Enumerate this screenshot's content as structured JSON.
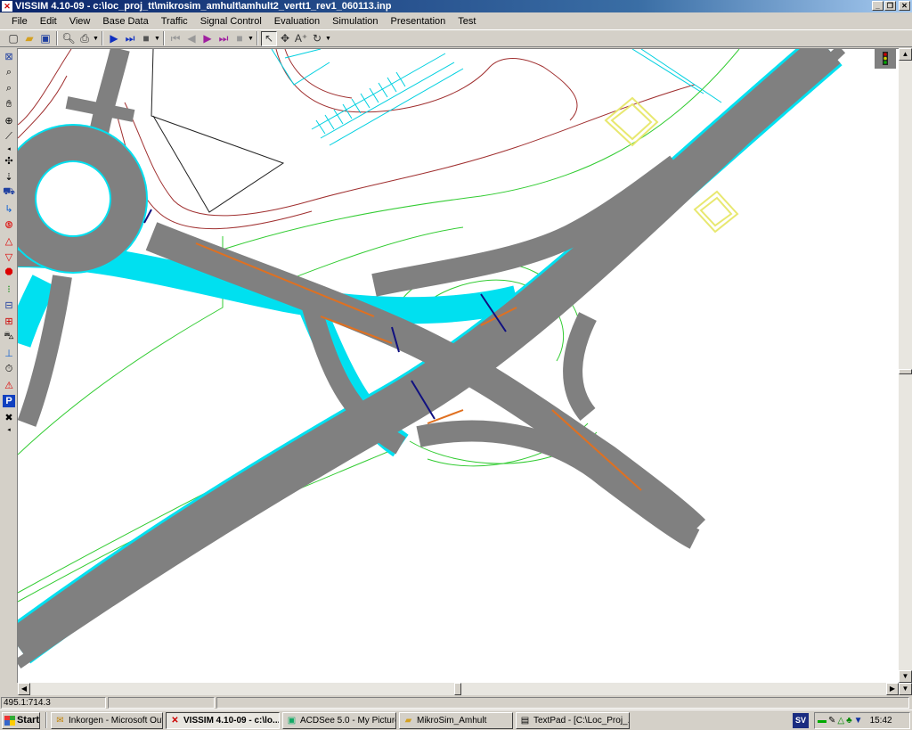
{
  "window": {
    "title": "VISSIM 4.10-09 - c:\\loc_proj_tt\\mikrosim_amhult\\amhult2_vertt1_rev1_060113.inp"
  },
  "menu": [
    {
      "label": "File"
    },
    {
      "label": "Edit"
    },
    {
      "label": "View"
    },
    {
      "label": "Base Data"
    },
    {
      "label": "Traffic"
    },
    {
      "label": "Signal Control"
    },
    {
      "label": "Evaluation"
    },
    {
      "label": "Simulation"
    },
    {
      "label": "Presentation"
    },
    {
      "label": "Test"
    }
  ],
  "toolbar": {
    "icons": [
      "new-file",
      "open-folder",
      "save-disk",
      "print-preview",
      "print",
      "play",
      "step",
      "stop",
      "rewind",
      "back",
      "forward-animation",
      "forward-step",
      "stop-animation",
      "select-pointer",
      "move-network",
      "add-text",
      "rotate"
    ]
  },
  "palette": {
    "icons": [
      "network-window",
      "zoom-in",
      "zoom-out",
      "pan-hand",
      "zoom-network",
      "link-tool",
      "node-tool",
      "vehicle-input",
      "routing",
      "speed-limit",
      "warning-sign",
      "give-way-sign",
      "stop-sign",
      "signal-head",
      "detector",
      "transit-stop",
      "bus-route",
      "measurement-section",
      "travel-time",
      "conflict-area",
      "parking-lot",
      "crossing-tool"
    ]
  },
  "status": {
    "coordinates": "495.1:714.3"
  },
  "taskbar": {
    "start": "Start",
    "tasks": [
      {
        "label": "Inkorgen - Microsoft Outl...",
        "icon": "outlook-icon",
        "active": false
      },
      {
        "label": "VISSIM 4.10-09 - c:\\lo...",
        "icon": "vissim-icon",
        "active": true
      },
      {
        "label": "ACDSee 5.0 - My Pictures",
        "icon": "acdsee-icon",
        "active": false
      },
      {
        "label": "MikroSim_Amhult",
        "icon": "folder-icon",
        "active": false
      },
      {
        "label": "TextPad - [C:\\Loc_Proj_...",
        "icon": "textpad-icon",
        "active": false
      }
    ],
    "language": "SV",
    "clock": "15:42"
  },
  "colors": {
    "road": "#808080",
    "edge_cyan": "#00e0f0",
    "contour_green": "#33cc33",
    "contour_red": "#a03030",
    "connector_orange": "#e07020",
    "signal_line": "#101080",
    "building_yellow": "#e8e870",
    "title_bar": "#0a246a"
  }
}
